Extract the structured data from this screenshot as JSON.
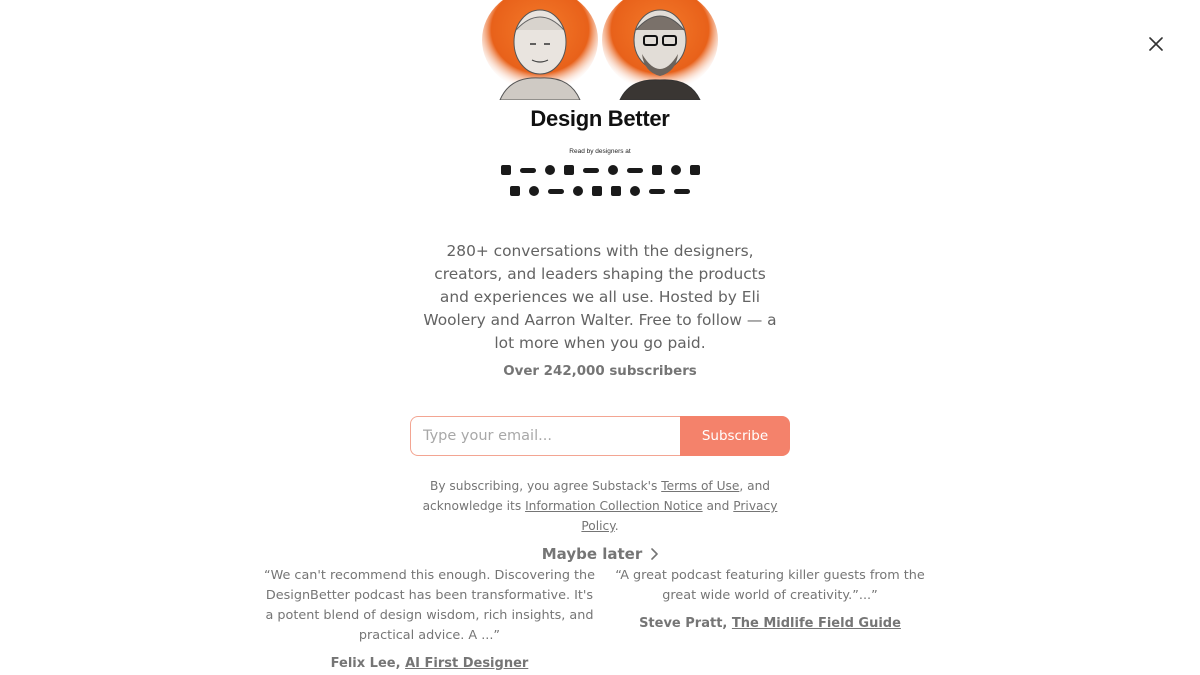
{
  "close": {
    "icon": "close-icon"
  },
  "cover": {
    "title": "Design Better",
    "read_by": "Read by designers at"
  },
  "description": "280+ conversations with the designers, creators, and leaders shaping the products and experiences we all use. Hosted by Eli Woolery and Aarron Walter. Free to follow — a lot more when you go paid.",
  "subscribers": "Over 242,000 subscribers",
  "form": {
    "email_placeholder": "Type your email...",
    "email_value": "",
    "subscribe_label": "Subscribe"
  },
  "legal": {
    "prefix": "By subscribing, you agree Substack's ",
    "terms": "Terms of Use",
    "middle": ", and acknowledge its ",
    "notice": "Information Collection Notice",
    "and": " and ",
    "privacy": "Privacy Policy",
    "end": "."
  },
  "maybe_later": "Maybe later",
  "testimonials": [
    {
      "quote": "“We can't recommend this enough. Discovering the DesignBetter podcast has been transformative. It's a potent blend of design wisdom, rich insights, and practical advice. A ...”",
      "author": "Felix Lee, ",
      "publication": "AI First Designer"
    },
    {
      "quote": "“A great podcast featuring killer guests from the great wide world of creativity.”...”",
      "author": "Steve Pratt, ",
      "publication": "The Midlife Field Guide"
    }
  ],
  "colors": {
    "accent": "#f4826b",
    "text_muted": "#757575",
    "text_body": "#636363"
  }
}
